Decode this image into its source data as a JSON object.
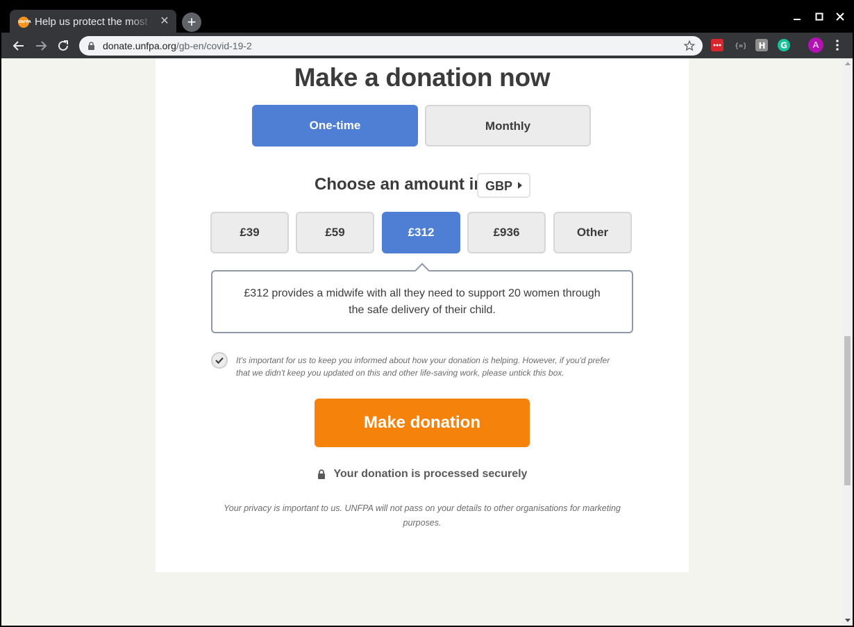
{
  "browser": {
    "tab_title": "Help us protect the most vulnerable",
    "favicon_text": "UNFPA",
    "url_host": "donate.unfpa.org",
    "url_path": "/gb-en/covid-19-2",
    "avatar_letter": "A"
  },
  "donation": {
    "heading": "Make a donation now",
    "frequency": [
      {
        "label": "One-time",
        "selected": true
      },
      {
        "label": "Monthly",
        "selected": false
      }
    ],
    "choose_label": "Choose an amount in",
    "currency": "GBP",
    "amounts": [
      {
        "label": "£39",
        "selected": false
      },
      {
        "label": "£59",
        "selected": false
      },
      {
        "label": "£312",
        "selected": true
      },
      {
        "label": "£936",
        "selected": false
      },
      {
        "label": "Other",
        "selected": false
      }
    ],
    "impact_text": "£312 provides a midwife with all they need to support 20 women through the safe delivery of their child.",
    "optin_checked": true,
    "optin_text": "It's important for us to keep you informed about how your donation is helping. However, if you'd prefer that we didn't keep you updated on this and other life-saving work, please untick this box.",
    "donate_button": "Make donation",
    "secure_text": "Your donation is processed securely",
    "privacy_text": "Your privacy is important to us. UNFPA will not pass on your details to other organisations for marketing purposes."
  },
  "colors": {
    "selected_blue": "#4f7fd4",
    "donate_orange": "#f5820a",
    "page_background": "#f4f4ef"
  }
}
